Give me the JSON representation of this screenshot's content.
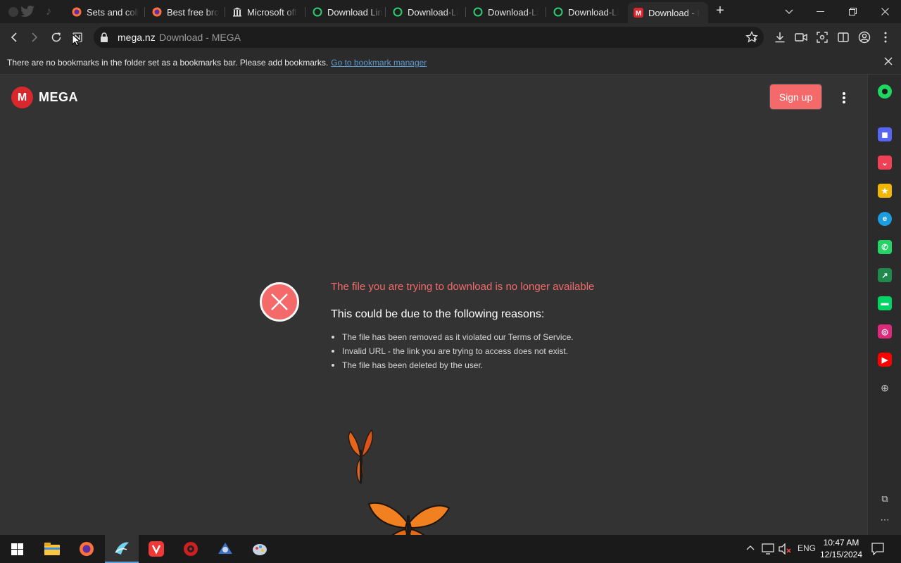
{
  "tabs": [
    {
      "label": "Sets and coll",
      "icon": "firefox-icon"
    },
    {
      "label": "Best free bro",
      "icon": "firefox-icon"
    },
    {
      "label": "Microsoft off",
      "icon": "bank-icon"
    },
    {
      "label": "Download Lin",
      "icon": "green-circle-icon"
    },
    {
      "label": "Download-Li",
      "icon": "green-circle-icon"
    },
    {
      "label": "Download-Li",
      "icon": "green-circle-icon"
    },
    {
      "label": "Download-Li",
      "icon": "green-circle-icon"
    },
    {
      "label": "Download - I",
      "icon": "mega-icon",
      "active": true
    }
  ],
  "newtab_label": "+",
  "address": {
    "host": "mega.nz",
    "title": "Download - MEGA"
  },
  "bookmarks_bar": {
    "message": "There are no bookmarks in the folder set as a bookmarks bar. Please add bookmarks.",
    "link": "Go to bookmark manager"
  },
  "page": {
    "logo_letter": "M",
    "logo_text": "MEGA",
    "signup_label": "Sign up",
    "error_title": "The file you are trying to download is no longer available",
    "error_subtitle": "This could be due to the following reasons:",
    "reasons": [
      "The file has been removed as it violated our Terms of Service.",
      "Invalid URL - the link you are trying to access does not exist.",
      "The file has been deleted by the user."
    ]
  },
  "sidebar": [
    {
      "icon": "spotify-icon",
      "color": "#1ed760"
    },
    {
      "icon": "discord-icon",
      "color": "#5865f2"
    },
    {
      "icon": "pocket-icon",
      "color": "#ef4056"
    },
    {
      "icon": "star-icon",
      "color": "#f2b705"
    },
    {
      "icon": "edge-icon",
      "color": "#1b9de2"
    },
    {
      "icon": "whatsapp-icon",
      "color": "#25d366"
    },
    {
      "icon": "chart-icon",
      "color": "#1f8a4c"
    },
    {
      "icon": "webtoon-icon",
      "color": "#00d564"
    },
    {
      "icon": "instagram-icon",
      "color": "#dd2a7b"
    },
    {
      "icon": "youtube-icon",
      "color": "#ff0000"
    }
  ],
  "taskbar": {
    "apps": [
      "start-icon",
      "file-explorer-icon",
      "firefox-icon",
      "browser-icon",
      "vivaldi-icon",
      "security-app-icon",
      "app-icon-1",
      "app-icon-2"
    ],
    "language": "ENG",
    "time": "10:47 AM",
    "date": "12/15/2024"
  },
  "colors": {
    "accent": "#f46a6a",
    "mega_red": "#d9272e"
  }
}
